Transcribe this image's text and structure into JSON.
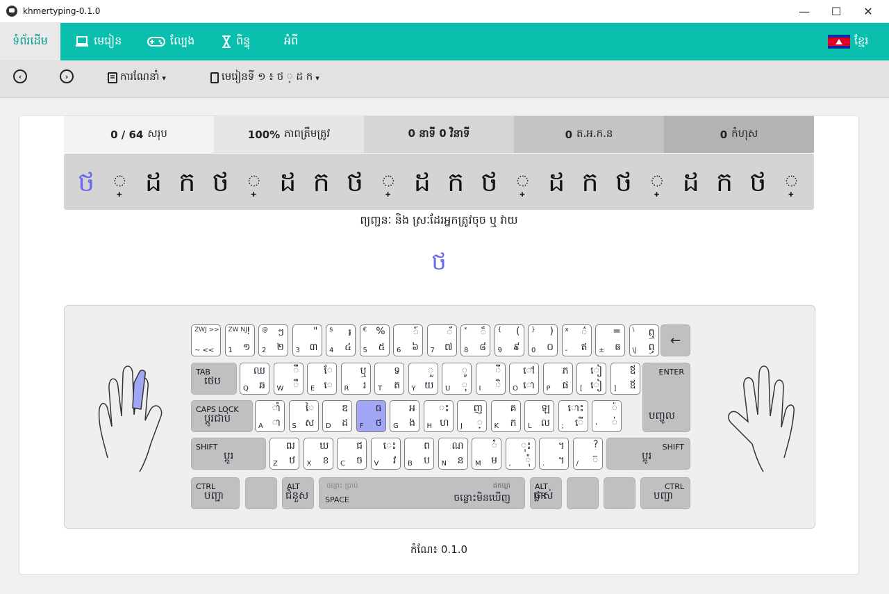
{
  "window": {
    "title": "khmertyping-0.1.0",
    "min": "—",
    "max": "☐",
    "close": "✕"
  },
  "nav": {
    "home": "ទំព័រដើម",
    "lessons": "មេរៀន",
    "games": "ល្បែង",
    "stats": "ពិន្ទុ",
    "about": "អំពី",
    "language": "ខ្មែរ"
  },
  "toolbar": {
    "prev": "‹",
    "next": "›",
    "instructions": "ការណែនាំ",
    "lesson": "មេរៀនទី ១ ៖ ថ ◌្ ដ ក",
    "caret": "▾"
  },
  "stats": {
    "count_value": "0 / 64",
    "count_label": "សរុប",
    "accuracy_value": "100%",
    "accuracy_label": "ភាពត្រឹមត្រូវ",
    "time": "0 នាទី 0 វិនាទី",
    "wpm_value": "0",
    "wpm_label": "ត.អ.ក.ន",
    "errors_value": "0",
    "errors_label": "កំហុស"
  },
  "text_line": [
    "ថ",
    "◌្",
    "ដ",
    "ក",
    "ថ",
    "◌្",
    "ដ",
    "ក",
    "ថ",
    "◌្",
    "ដ",
    "ក",
    "ថ",
    "◌្",
    "ដ",
    "ក",
    "ថ",
    "◌្",
    "ដ",
    "ក",
    "ថ",
    "◌្"
  ],
  "hint": "ព្យញ្ជនៈ និង ស្រៈដែរអ្នកត្រូវចុច ឬ វាយ",
  "current_char": "ថ",
  "keyboard": {
    "row1": [
      {
        "tl": "ZWJ >>",
        "bl": "~ <<",
        "tr": "",
        "br": ""
      },
      {
        "tl": "ZW NJ",
        "bl": "1",
        "tr": "!",
        "br": "១"
      },
      {
        "tl": "@",
        "bl": "2",
        "tr": "ៗ",
        "br": "២"
      },
      {
        "tl": "",
        "bl": "3",
        "tr": "\"",
        "br": "៣"
      },
      {
        "tl": "$",
        "bl": "4",
        "tr": "៛",
        "br": "៤"
      },
      {
        "tl": "€",
        "bl": "5",
        "tr": "%",
        "br": "៥"
      },
      {
        "tl": "",
        "bl": "6",
        "tr": "៍",
        "br": "៦"
      },
      {
        "tl": "",
        "bl": "7",
        "tr": "័",
        "br": "៧"
      },
      {
        "tl": "*",
        "bl": "8",
        "tr": "៏",
        "br": "៨"
      },
      {
        "tl": "{",
        "bl": "9",
        "tr": "(",
        "br": "៩"
      },
      {
        "tl": "}",
        "bl": "0",
        "tr": ")",
        "br": "០"
      },
      {
        "tl": "x",
        "bl": "-",
        "tr": "៌",
        "br": "ឥ"
      },
      {
        "tl": "",
        "bl": "±",
        "tr": "=",
        "br": "ឲ"
      },
      {
        "tl": "\\",
        "bl": "\\|",
        "tr": "ឮ",
        "br": "ឭ"
      }
    ],
    "backspace": "←",
    "tab": {
      "label": "TAB",
      "khmer": "ថេប"
    },
    "row2": [
      {
        "bl": "Q",
        "tr": "ឈ",
        "br": "ឆ"
      },
      {
        "bl": "W",
        "tr": "ឺ",
        "br": "ឹ"
      },
      {
        "bl": "E",
        "tr": "ែ",
        "br": "េ"
      },
      {
        "bl": "R",
        "tr": "ឬ",
        "br": "រ"
      },
      {
        "bl": "T",
        "tr": "ទ",
        "br": "ត"
      },
      {
        "bl": "Y",
        "tr": "ួ",
        "br": "យ"
      },
      {
        "bl": "U",
        "tr": "ូ",
        "br": "ុ"
      },
      {
        "bl": "I",
        "tr": "ី",
        "br": "ិ"
      },
      {
        "bl": "O",
        "tr": "ៅ",
        "br": "ោ"
      },
      {
        "bl": "P",
        "tr": "ភ",
        "br": "ផ"
      },
      {
        "bl": "[",
        "tr": "ៀ",
        "br": "ៀ"
      },
      {
        "bl": "]",
        "tr": "ឪ",
        "br": "ឪ"
      }
    ],
    "enter": {
      "label": "ENTER",
      "khmer": "បញ្ចូល"
    },
    "caps": {
      "label": "CAPS LOCK",
      "khmer": "ប្តូរជាប់"
    },
    "row3": [
      {
        "bl": "A",
        "tr": "ាំ",
        "br": "ា"
      },
      {
        "bl": "S",
        "tr": "ៃ",
        "br": "ស"
      },
      {
        "bl": "D",
        "tr": "ឌ",
        "br": "ដ"
      },
      {
        "bl": "F",
        "tr": "ធ",
        "br": "ថ"
      },
      {
        "bl": "G",
        "tr": "អ",
        "br": "ង"
      },
      {
        "bl": "H",
        "tr": "ះ",
        "br": "ហ"
      },
      {
        "bl": "J",
        "tr": "ញ",
        "br": "្"
      },
      {
        "bl": "K",
        "tr": "គ",
        "br": "ក"
      },
      {
        "bl": "L",
        "tr": "ឡ",
        "br": "ល"
      },
      {
        "bl": ";",
        "tr": "ោះ",
        "br": "ើ"
      },
      {
        "bl": "'",
        "tr": "៉",
        "br": "់"
      }
    ],
    "shift_left": {
      "label": "SHIFT",
      "khmer": "ប្តូរ"
    },
    "row4": [
      {
        "bl": "Z",
        "tr": "ឍ",
        "br": "ឋ"
      },
      {
        "bl": "X",
        "tr": "ឃ",
        "br": "ខ"
      },
      {
        "bl": "C",
        "tr": "ជ",
        "br": "ច"
      },
      {
        "bl": "V",
        "tr": "េះ",
        "br": "វ"
      },
      {
        "bl": "B",
        "tr": "ព",
        "br": "ប"
      },
      {
        "bl": "N",
        "tr": "ណ",
        "br": "ន"
      },
      {
        "bl": "M",
        "tr": "ំ",
        "br": "ម"
      },
      {
        "bl": ",",
        "tr": "ុះ",
        "br": "ុំ"
      },
      {
        "bl": ".",
        "tr": "។",
        "br": "។"
      },
      {
        "bl": "/",
        "tr": "?",
        "br": "៊"
      }
    ],
    "shift_right": {
      "label": "SHIFT",
      "khmer": "ប្តូរ"
    },
    "ctrl_left": {
      "label": "CTRL",
      "khmer": "បញ្ជា"
    },
    "alt": {
      "label": "ALT",
      "khmer": "ជំនួស"
    },
    "space": {
      "label": "SPACE",
      "tl": "ចន្លោះ ប្រាប់",
      "tr": "ដកឃ្លា",
      "br": "ចន្លោះមិនឃើញ"
    },
    "altgr": {
      "label": "ALT GR",
      "khmer": "ផ្លាស់"
    },
    "ctrl_right": {
      "label": "CTRL",
      "khmer": "បញ្ជា"
    }
  },
  "version": "កំណែ៖ 0.1.0",
  "colors": {
    "accent": "#0bbfae",
    "highlight": "#a1a7f4",
    "current": "#6a6af0"
  }
}
